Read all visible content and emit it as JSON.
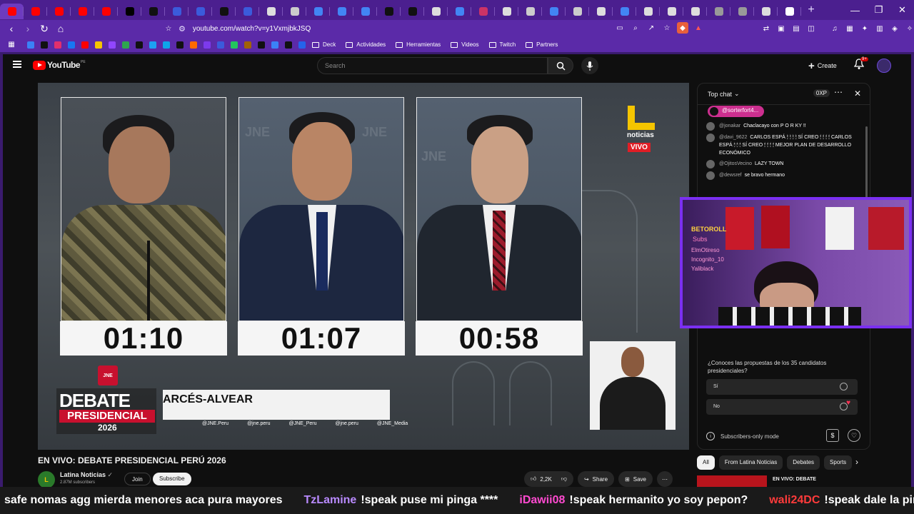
{
  "browser": {
    "tabs": [
      {
        "icon": "youtube-favicon-icon",
        "color": "#ff0000"
      },
      {
        "icon": "youtube-favicon-icon",
        "color": "#ff0000"
      },
      {
        "icon": "youtube-favicon-icon",
        "color": "#ff0000"
      },
      {
        "icon": "youtube-favicon-icon",
        "color": "#ff0000"
      },
      {
        "icon": "youtube-favicon-icon",
        "color": "#ff0000"
      },
      {
        "icon": "x-favicon-icon",
        "color": "#000000"
      },
      {
        "icon": "tiktok-favicon-icon",
        "color": "#111111"
      },
      {
        "icon": "kick-favicon-icon",
        "color": "#3b5bdb"
      },
      {
        "icon": "kick-favicon-icon",
        "color": "#3b5bdb"
      },
      {
        "icon": "tiktok-favicon-icon",
        "color": "#111111"
      },
      {
        "icon": "kick-favicon-icon",
        "color": "#3b5bdb"
      },
      {
        "icon": "chat-favicon-icon",
        "color": "#dddddd"
      },
      {
        "icon": "web-favicon-icon",
        "color": "#cccccc"
      },
      {
        "icon": "google-favicon-icon",
        "color": "#4285f4"
      },
      {
        "icon": "google-favicon-icon",
        "color": "#4285f4"
      },
      {
        "icon": "google-favicon-icon",
        "color": "#4285f4"
      },
      {
        "icon": "tiktok-favicon-icon",
        "color": "#111111"
      },
      {
        "icon": "tiktok-favicon-icon",
        "color": "#111111"
      },
      {
        "icon": "chat-favicon-icon",
        "color": "#dddddd"
      },
      {
        "icon": "google-favicon-icon",
        "color": "#4285f4"
      },
      {
        "icon": "web-favicon-icon",
        "color": "#cc3366"
      },
      {
        "icon": "chat-favicon-icon",
        "color": "#dddddd"
      },
      {
        "icon": "shield-favicon-icon",
        "color": "#cccccc"
      },
      {
        "icon": "google-favicon-icon",
        "color": "#4285f4"
      },
      {
        "icon": "web-favicon-icon",
        "color": "#cccccc"
      },
      {
        "icon": "chat-favicon-icon",
        "color": "#dddddd"
      },
      {
        "icon": "google-favicon-icon",
        "color": "#4285f4"
      },
      {
        "icon": "chat-favicon-icon",
        "color": "#dddddd"
      },
      {
        "icon": "chat-favicon-icon",
        "color": "#dddddd"
      },
      {
        "icon": "chat-favicon-icon",
        "color": "#dddddd"
      },
      {
        "icon": "web-favicon-icon",
        "color": "#999999"
      },
      {
        "icon": "web-favicon-icon",
        "color": "#999999"
      },
      {
        "icon": "chat-favicon-icon",
        "color": "#dddddd"
      },
      {
        "icon": "twitch-favicon-icon",
        "color": "#ffffff"
      }
    ],
    "url": "youtube.com/watch?v=y1VxmjbkJSQ",
    "bookmarks": {
      "folders": [
        "Deck",
        "Actividades",
        "Herramientas",
        "Videos",
        "Twitch",
        "Partners"
      ]
    }
  },
  "youtube": {
    "logo_text": "YouTube",
    "logo_country": "PE",
    "search_placeholder": "Search",
    "create_label": "Create",
    "notifications_badge": "9+"
  },
  "video": {
    "timers": [
      "01:10",
      "01:07",
      "00:58"
    ],
    "broadcaster_logo": "noticias",
    "live_badge": "VIVO",
    "jne_label": "JNE",
    "debate_title": "DEBATE",
    "debate_subtitle": "PRESIDENCIAL",
    "debate_year": "2026",
    "name_bar": "ARCÉS-ALVEAR",
    "socials": [
      "@JNE.Peru",
      "@jne.peru",
      "@JNE_Peru",
      "@jne.peru",
      "@JNE_Media"
    ],
    "watermark": "JNE",
    "title": "EN VIVO: DEBATE PRESIDENCIAL PERÚ 2026"
  },
  "channel": {
    "name": "Latina Noticias",
    "subscribers": "2.87M subscribers",
    "join_label": "Join",
    "subscribe_label": "Subscribe"
  },
  "actions": {
    "likes": "2,2K",
    "share_label": "Share",
    "save_label": "Save"
  },
  "chat": {
    "header": "Top chat",
    "xp_label": "0XP",
    "pinned_user": "@sorterfort4...",
    "messages": [
      {
        "author": "@jonakar",
        "text": "Chaclacayo con P O R KY !!"
      },
      {
        "author": "@davi_9622",
        "text": "CARLOS ESPÁ 🕯 🕯 🕯 🕯 SÍ CREO 🕯 🕯 🕯 🕯 CARLOS ESPÁ 🕯 🕯 🕯 SÍ CREO 🕯 🕯 🕯 🕯 MEJOR PLAN DE DESARROLLO ECONÓMICO"
      },
      {
        "author": "@OjitosVecino",
        "text": "LAZY TOWN"
      },
      {
        "author": "@dewsref",
        "text": "se bravo hermano"
      }
    ],
    "poll_question": "¿Conoces las propuestas de los 35 candidatos presidenciales?",
    "poll_options": [
      "Sí",
      "No"
    ],
    "subscribers_only": "Subscribers-only mode"
  },
  "recommendations": {
    "chips": [
      "All",
      "From Latina Noticias",
      "Debates",
      "Sports"
    ],
    "next_title": "EN VIVO: DEBATE"
  },
  "stream_overlay": {
    "brand": "BETOROLL",
    "subs_label": "Subs",
    "names": [
      "ElmOtireso",
      "Incognito_10",
      "Yaliblack"
    ]
  },
  "ticker": [
    {
      "user": "",
      "text": "safe nomas agg mierda menores aca pura mayores",
      "color": "#ffffff"
    },
    {
      "user": "TzLamine",
      "text": "!speak puse mi pinga ****",
      "color": "#b98aff"
    },
    {
      "user": "iDawii08",
      "text": "!speak hermanito yo soy pepon?",
      "color": "#ff4ad0"
    },
    {
      "user": "wali24DC",
      "text": "!speak dale la pinga a ese kabro",
      "color": "#ff3b3b"
    }
  ]
}
